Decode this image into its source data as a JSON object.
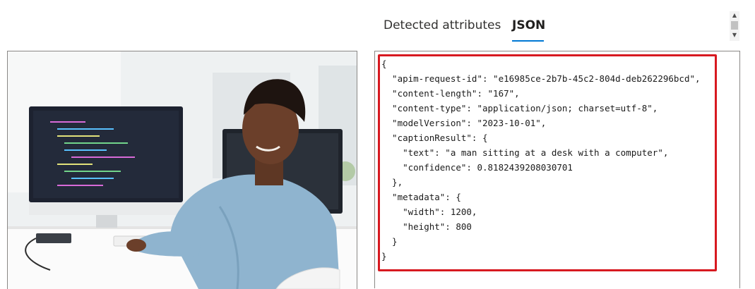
{
  "tabs": {
    "detected_label": "Detected attributes",
    "json_label": "JSON",
    "active": "JSON"
  },
  "colors": {
    "accent": "#0078d4",
    "highlight": "#d71920"
  },
  "image": {
    "alt": "man sitting at a desk with a computer, smiling over his shoulder"
  },
  "json_lines": [
    "{",
    "  \"apim-request-id\": \"e16985ce-2b7b-45c2-804d-deb262296bcd\",",
    "  \"content-length\": \"167\",",
    "  \"content-type\": \"application/json; charset=utf-8\",",
    "  \"modelVersion\": \"2023-10-01\",",
    "  \"captionResult\": {",
    "    \"text\": \"a man sitting at a desk with a computer\",",
    "    \"confidence\": 0.8182439208030701",
    "  },",
    "  \"metadata\": {",
    "    \"width\": 1200,",
    "    \"height\": 800",
    "  }",
    "}"
  ],
  "scrollbar": {
    "up_icon": "▲",
    "down_icon": "▼"
  }
}
